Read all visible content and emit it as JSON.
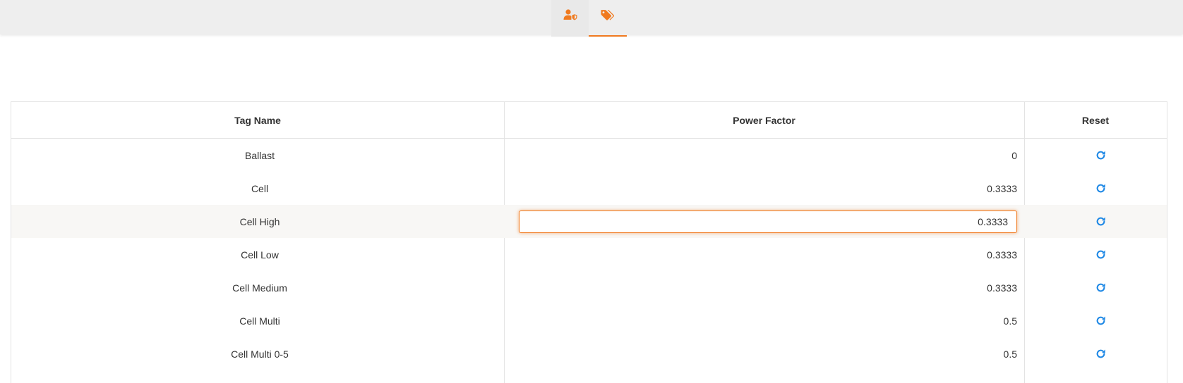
{
  "nav": {
    "tabs": [
      {
        "icon": "user-shield-icon",
        "active": false
      },
      {
        "icon": "tags-icon",
        "active": true
      }
    ],
    "accent_color": "#f07a1f"
  },
  "table": {
    "headers": {
      "tag_name": "Tag Name",
      "power_factor": "Power Factor",
      "reset": "Reset"
    },
    "rows": [
      {
        "tag_name": "Ballast",
        "power_factor": "0"
      },
      {
        "tag_name": "Cell",
        "power_factor": "0.3333"
      },
      {
        "tag_name": "Cell High",
        "power_factor": "0.3333",
        "editing": true
      },
      {
        "tag_name": "Cell Low",
        "power_factor": "0.3333"
      },
      {
        "tag_name": "Cell Medium",
        "power_factor": "0.3333"
      },
      {
        "tag_name": "Cell Multi",
        "power_factor": "0.5"
      },
      {
        "tag_name": "Cell Multi 0-5",
        "power_factor": "0.5"
      }
    ],
    "reset_icon": "refresh-icon",
    "reset_icon_color": "#1e88e5"
  }
}
